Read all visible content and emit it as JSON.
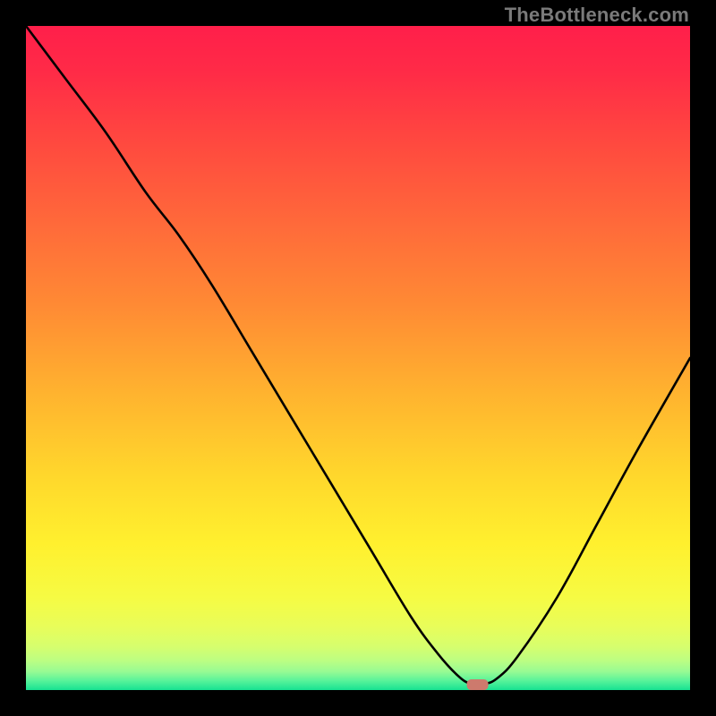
{
  "watermark": "TheBottleneck.com",
  "chart_data": {
    "type": "line",
    "title": "",
    "xlabel": "",
    "ylabel": "",
    "xlim": [
      0,
      100
    ],
    "ylim": [
      0,
      100
    ],
    "grid": false,
    "legend": false,
    "notes": "Unlabeled bottleneck curve over a red→yellow→green vertical gradient background; minimum indicated near x≈68. No axis ticks or numeric labels are shown; x/y values are parametrised 0–100 estimates of the drawn curve.",
    "series": [
      {
        "name": "curve",
        "x": [
          0,
          6,
          12,
          18,
          23,
          28,
          34,
          40,
          46,
          52,
          58,
          62,
          65,
          67,
          69,
          71,
          74,
          80,
          86,
          92,
          100
        ],
        "y": [
          100,
          92,
          84,
          75,
          68.5,
          61,
          51,
          41,
          31,
          21,
          11,
          5.5,
          2.2,
          0.9,
          0.9,
          1.8,
          5,
          14,
          25,
          36,
          50
        ]
      }
    ],
    "marker": {
      "x": 68,
      "y": 0.8,
      "color": "#cd7a6d"
    },
    "gradient_stops": [
      {
        "offset": 0.0,
        "color": "#ff1f4a"
      },
      {
        "offset": 0.07,
        "color": "#ff2b47"
      },
      {
        "offset": 0.18,
        "color": "#ff4a3f"
      },
      {
        "offset": 0.3,
        "color": "#ff6a3a"
      },
      {
        "offset": 0.42,
        "color": "#ff8a34"
      },
      {
        "offset": 0.55,
        "color": "#ffb22f"
      },
      {
        "offset": 0.68,
        "color": "#ffd82c"
      },
      {
        "offset": 0.78,
        "color": "#fff02e"
      },
      {
        "offset": 0.86,
        "color": "#f6fb43"
      },
      {
        "offset": 0.905,
        "color": "#e8fd5a"
      },
      {
        "offset": 0.935,
        "color": "#d6fe6e"
      },
      {
        "offset": 0.955,
        "color": "#bdfe82"
      },
      {
        "offset": 0.972,
        "color": "#98fb93"
      },
      {
        "offset": 0.986,
        "color": "#58f39a"
      },
      {
        "offset": 1.0,
        "color": "#17e292"
      }
    ]
  }
}
